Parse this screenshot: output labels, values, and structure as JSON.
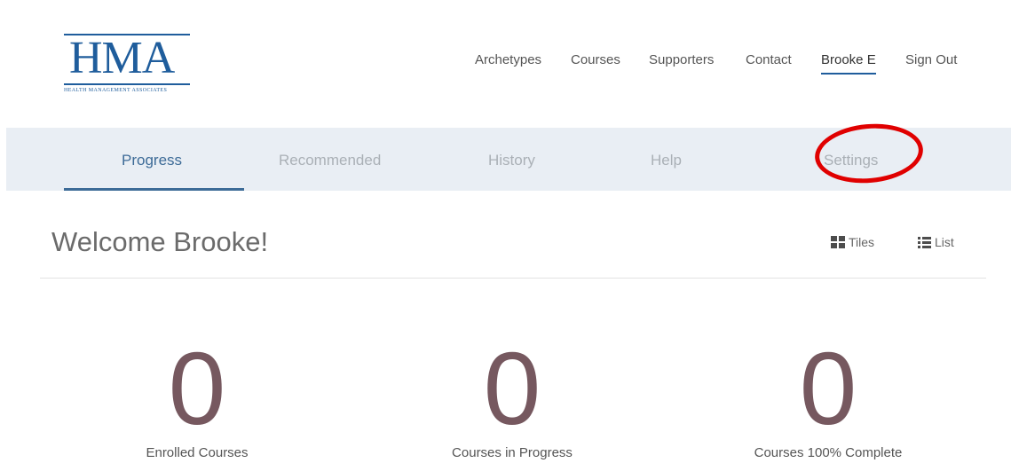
{
  "logo": {
    "text": "HMA",
    "subtitle": "Health Management Associates"
  },
  "topnav": [
    {
      "label": "Archetypes",
      "active": false
    },
    {
      "label": "Courses",
      "active": false
    },
    {
      "label": "Supporters",
      "active": false
    },
    {
      "label": "Contact",
      "active": false
    },
    {
      "label": "Brooke E",
      "active": true
    },
    {
      "label": "Sign Out",
      "active": false
    }
  ],
  "subnav": [
    {
      "label": "Progress",
      "active": true
    },
    {
      "label": "Recommended",
      "active": false
    },
    {
      "label": "History",
      "active": false
    },
    {
      "label": "Help",
      "active": false
    },
    {
      "label": "Settings",
      "active": false
    }
  ],
  "welcome": "Welcome Brooke!",
  "views": {
    "tiles": "Tiles",
    "list": "List"
  },
  "stats": [
    {
      "value": "0",
      "label": "Enrolled Courses"
    },
    {
      "value": "0",
      "label": "Courses in Progress"
    },
    {
      "value": "0",
      "label": "Courses 100% Complete"
    }
  ],
  "colors": {
    "brand": "#1f5d9c",
    "subnav_bg": "#e9eef4",
    "stat_number": "#76585f",
    "annotation_ring": "#e00000"
  }
}
